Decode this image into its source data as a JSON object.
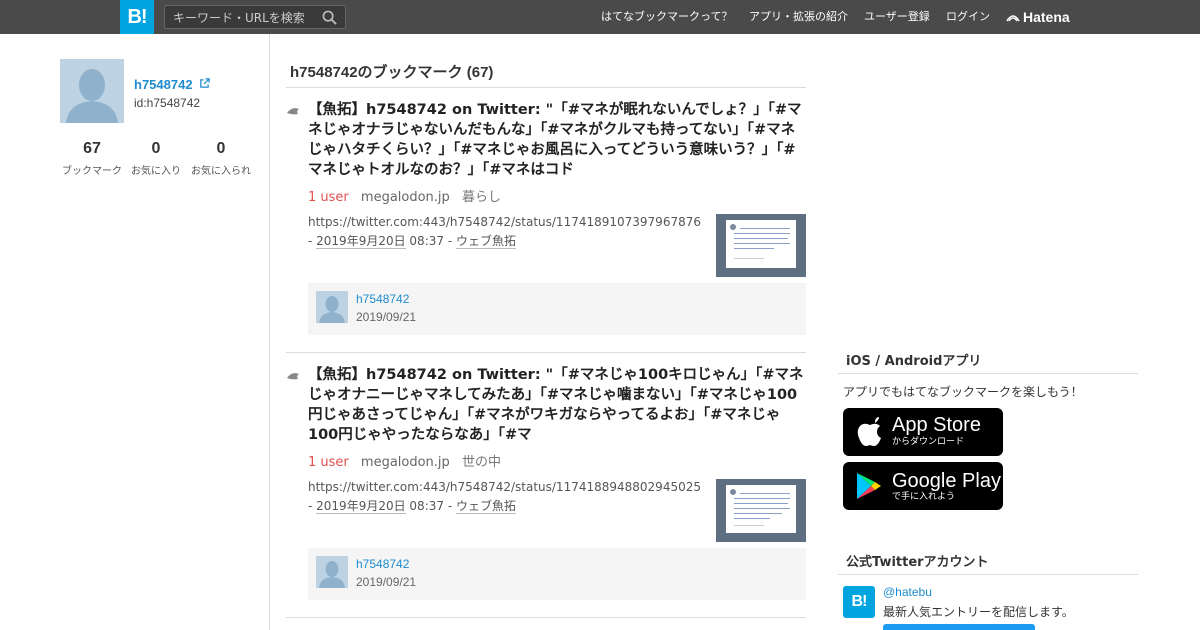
{
  "header": {
    "logo": "B!",
    "search_placeholder": "キーワード・URLを検索",
    "nav": [
      "はてなブックマークって？",
      "アプリ・拡張の紹介",
      "ユーザー登録",
      "ログイン"
    ],
    "brand": "Hatena",
    "bg_color": "#4a4a4a",
    "accent_color": "#00a4de"
  },
  "profile": {
    "username": "h7548742",
    "user_id": "id:h7548742",
    "stats": [
      {
        "num": "67",
        "label": "ブックマーク"
      },
      {
        "num": "0",
        "label": "お気に入り"
      },
      {
        "num": "0",
        "label": "お気に入られ"
      }
    ]
  },
  "main": {
    "title": "h7548742のブックマーク (67)",
    "entries": [
      {
        "title": "【魚拓】h7548742 on Twitter: \"「#マネが眠れないんでしょ？」「#マネじゃオナラじゃないんだもんな」「#マネがクルマも持ってない」「#マネじゃハタチくらい？」「#マネじゃお風呂に入ってどういう意味いう？」「#マネじゃトオルなのお？」「#マネはコド",
        "users": "1 user",
        "domain": "megalodon.jp",
        "category": "暮らし",
        "url": "https://twitter.com:443/h7548742/status/1174189107397967876",
        "sep1": " - ",
        "date_link": "2019年9月20日",
        "time": " 08:37 - ",
        "via": "ウェブ魚拓",
        "comment": {
          "user": "h7548742",
          "date": "2019/09/21"
        }
      },
      {
        "title": "【魚拓】h7548742 on Twitter: \"「#マネじゃ100キロじゃん」「#マネじゃオナニーじゃマネしてみたあ」「#マネじゃ噛まない」「#マネじゃ100円じゃあさってじゃん」「#マネがワキガならやってるよお」「#マネじゃ100円じゃやったならなあ」「#マ",
        "users": "1 user",
        "domain": "megalodon.jp",
        "category": "世の中",
        "url": "https://twitter.com:443/h7548742/status/1174188948802945025",
        "sep1": " - ",
        "date_link": "2019年9月20日",
        "time": " 08:37 - ",
        "via": "ウェブ魚拓",
        "comment": {
          "user": "h7548742",
          "date": "2019/09/21"
        }
      }
    ]
  },
  "sidebar": {
    "apps": {
      "title": "iOS / Androidアプリ",
      "text": "アプリでもはてなブックマークを楽しもう！",
      "appstore_big": "App Store",
      "appstore_small": "からダウンロード",
      "googleplay_big": "Google Play",
      "googleplay_small": "で手に入れよう"
    },
    "twitter": {
      "title": "公式Twitterアカウント",
      "logo": "B!",
      "handle": "@hatebu",
      "desc": "最新人気エントリーを配信します。"
    }
  }
}
